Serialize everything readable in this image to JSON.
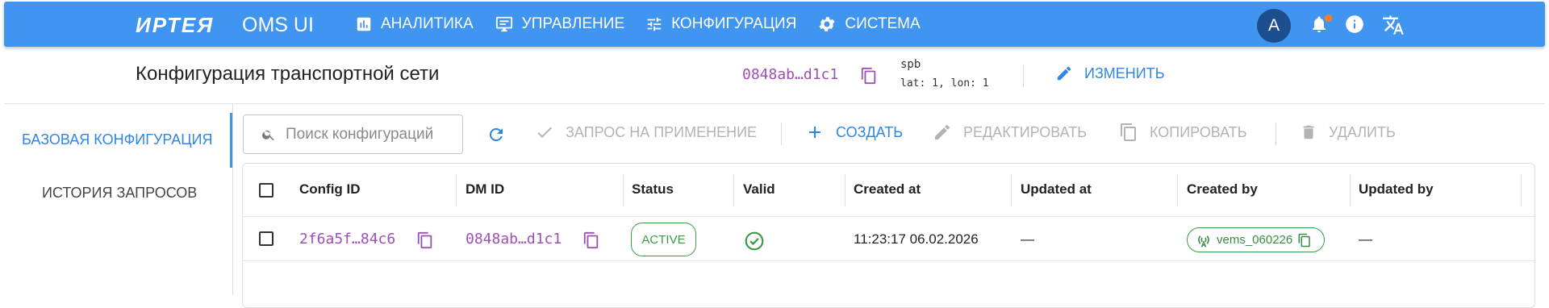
{
  "app": {
    "brand": "ИРТЕЯ",
    "product": "OMS UI"
  },
  "nav": [
    {
      "label": "АНАЛИТИКА",
      "icon": "chart-box-icon"
    },
    {
      "label": "УПРАВЛЕНИЕ",
      "icon": "monitor-edit-icon"
    },
    {
      "label": "КОНФИГУРАЦИЯ",
      "icon": "tune-sliders-icon"
    },
    {
      "label": "СИСТЕМА",
      "icon": "gear-icon"
    }
  ],
  "user": {
    "avatar_letter": "A"
  },
  "header": {
    "title": "Конфигурация транспортной сети",
    "dm_id": "0848ab…d1c1",
    "location_name": "spb",
    "location_coords": "lat: 1, lon: 1",
    "edit_label": "ИЗМЕНИТЬ"
  },
  "sidebar": {
    "items": [
      {
        "label": "БАЗОВАЯ КОНФИГУРАЦИЯ",
        "active": true
      },
      {
        "label": "ИСТОРИЯ ЗАПРОСОВ",
        "active": false
      }
    ]
  },
  "toolbar": {
    "search_placeholder": "Поиск конфигураций",
    "apply_request": "ЗАПРОС НА ПРИМЕНЕНИЕ",
    "create": "СОЗДАТЬ",
    "edit": "РЕДАКТИРОВАТЬ",
    "copy": "КОПИРОВАТЬ",
    "delete": "УДАЛИТЬ"
  },
  "table": {
    "columns": [
      "Config ID",
      "DM ID",
      "Status",
      "Valid",
      "Created at",
      "Updated at",
      "Created by",
      "Updated by"
    ],
    "rows": [
      {
        "config_id": "2f6a5f…84c6",
        "dm_id": "0848ab…d1c1",
        "status": "ACTIVE",
        "valid": true,
        "created_at": "11:23:17 06.02.2026",
        "updated_at": "—",
        "created_by": "vems_060226",
        "updated_by": "—"
      }
    ]
  },
  "colors": {
    "primary": "#3f95f0",
    "accent_text": "#2f86e6",
    "mono_id": "#9d4fb3",
    "success": "#3a9b46",
    "notification_dot": "#ff7a21"
  }
}
